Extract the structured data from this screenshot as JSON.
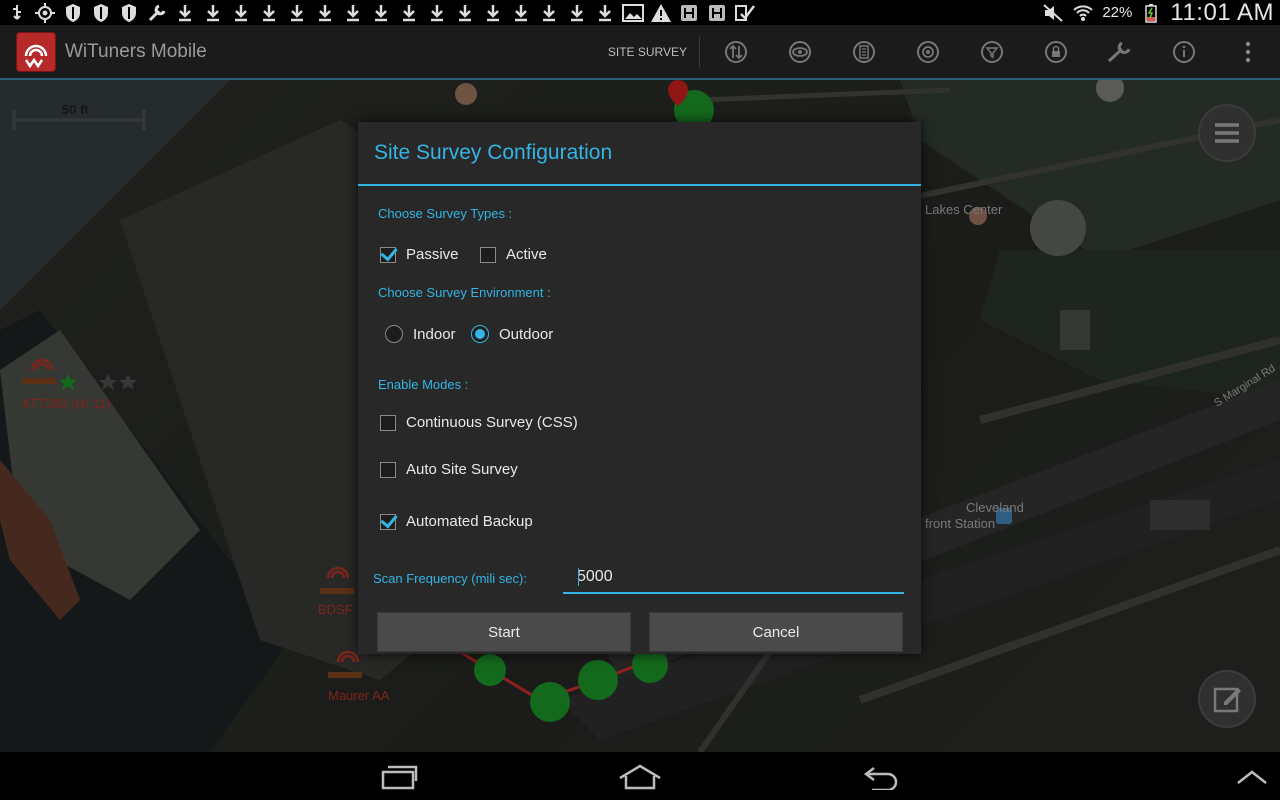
{
  "status_bar": {
    "left_icons": [
      "usb-icon",
      "gps-icon",
      "shield-icon",
      "shield-icon",
      "shield-icon",
      "wrench-icon",
      "download-icon",
      "download-icon",
      "download-icon",
      "download-icon",
      "download-icon",
      "download-icon",
      "download-icon",
      "download-icon",
      "download-icon",
      "download-icon",
      "download-icon",
      "download-icon",
      "download-icon",
      "download-icon",
      "download-icon",
      "download-icon",
      "image-icon",
      "warning-icon",
      "h-icon",
      "h-icon",
      "check-icon"
    ],
    "battery_percent": "22%",
    "time": "11:01 AM"
  },
  "action_bar": {
    "app_title": "WiTuners Mobile",
    "site_survey_label": "SITE SURVEY",
    "action_icons": [
      "transfer-icon",
      "eye-icon",
      "list-icon",
      "target-icon",
      "filter-icon",
      "lock-icon",
      "wrench-icon",
      "info-icon",
      "overflow-menu-icon"
    ]
  },
  "map": {
    "scale_label": "50 ft",
    "places": [
      "Lakes Center",
      "Cleveland",
      "front Station",
      "S Marginal Rd"
    ],
    "access_points": [
      "ATT280 (ch 11)",
      "BDSF",
      "Maurer AA"
    ]
  },
  "dialog": {
    "title": "Site Survey Configuration",
    "survey_types_label": "Choose Survey Types :",
    "survey_types": [
      {
        "label": "Passive",
        "checked": true
      },
      {
        "label": "Active",
        "checked": false
      }
    ],
    "environment_label": "Choose Survey Environment :",
    "environments": [
      {
        "label": "Indoor",
        "selected": false
      },
      {
        "label": "Outdoor",
        "selected": true
      }
    ],
    "modes_label": "Enable Modes :",
    "modes": [
      {
        "label": "Continuous Survey (CSS)",
        "checked": false
      },
      {
        "label": "Auto Site Survey",
        "checked": false
      },
      {
        "label": "Automated Backup",
        "checked": true
      }
    ],
    "scan_frequency_label": "Scan Frequency (mili sec):",
    "scan_frequency_value": "5000",
    "start_button": "Start",
    "cancel_button": "Cancel"
  },
  "nav_bar": {
    "buttons": [
      "recent-apps-icon",
      "home-icon",
      "back-icon",
      "chevron-up-icon"
    ]
  },
  "colors": {
    "accent": "#33b5e5",
    "dialog_bg": "#282828",
    "button_bg": "#4a4a4a",
    "app_logo": "#b72a2a"
  }
}
